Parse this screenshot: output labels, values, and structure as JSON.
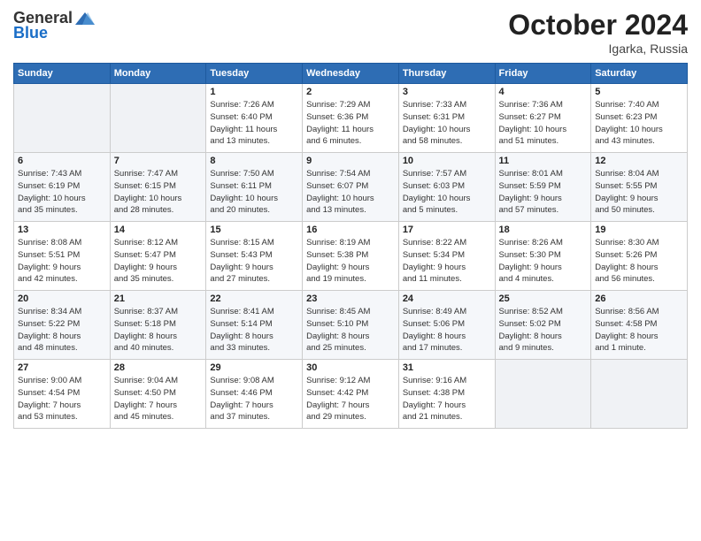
{
  "logo": {
    "general": "General",
    "blue": "Blue"
  },
  "header": {
    "title": "October 2024",
    "location": "Igarka, Russia"
  },
  "days_of_week": [
    "Sunday",
    "Monday",
    "Tuesday",
    "Wednesday",
    "Thursday",
    "Friday",
    "Saturday"
  ],
  "weeks": [
    [
      {
        "day": "",
        "info": ""
      },
      {
        "day": "",
        "info": ""
      },
      {
        "day": "1",
        "info": "Sunrise: 7:26 AM\nSunset: 6:40 PM\nDaylight: 11 hours\nand 13 minutes."
      },
      {
        "day": "2",
        "info": "Sunrise: 7:29 AM\nSunset: 6:36 PM\nDaylight: 11 hours\nand 6 minutes."
      },
      {
        "day": "3",
        "info": "Sunrise: 7:33 AM\nSunset: 6:31 PM\nDaylight: 10 hours\nand 58 minutes."
      },
      {
        "day": "4",
        "info": "Sunrise: 7:36 AM\nSunset: 6:27 PM\nDaylight: 10 hours\nand 51 minutes."
      },
      {
        "day": "5",
        "info": "Sunrise: 7:40 AM\nSunset: 6:23 PM\nDaylight: 10 hours\nand 43 minutes."
      }
    ],
    [
      {
        "day": "6",
        "info": "Sunrise: 7:43 AM\nSunset: 6:19 PM\nDaylight: 10 hours\nand 35 minutes."
      },
      {
        "day": "7",
        "info": "Sunrise: 7:47 AM\nSunset: 6:15 PM\nDaylight: 10 hours\nand 28 minutes."
      },
      {
        "day": "8",
        "info": "Sunrise: 7:50 AM\nSunset: 6:11 PM\nDaylight: 10 hours\nand 20 minutes."
      },
      {
        "day": "9",
        "info": "Sunrise: 7:54 AM\nSunset: 6:07 PM\nDaylight: 10 hours\nand 13 minutes."
      },
      {
        "day": "10",
        "info": "Sunrise: 7:57 AM\nSunset: 6:03 PM\nDaylight: 10 hours\nand 5 minutes."
      },
      {
        "day": "11",
        "info": "Sunrise: 8:01 AM\nSunset: 5:59 PM\nDaylight: 9 hours\nand 57 minutes."
      },
      {
        "day": "12",
        "info": "Sunrise: 8:04 AM\nSunset: 5:55 PM\nDaylight: 9 hours\nand 50 minutes."
      }
    ],
    [
      {
        "day": "13",
        "info": "Sunrise: 8:08 AM\nSunset: 5:51 PM\nDaylight: 9 hours\nand 42 minutes."
      },
      {
        "day": "14",
        "info": "Sunrise: 8:12 AM\nSunset: 5:47 PM\nDaylight: 9 hours\nand 35 minutes."
      },
      {
        "day": "15",
        "info": "Sunrise: 8:15 AM\nSunset: 5:43 PM\nDaylight: 9 hours\nand 27 minutes."
      },
      {
        "day": "16",
        "info": "Sunrise: 8:19 AM\nSunset: 5:38 PM\nDaylight: 9 hours\nand 19 minutes."
      },
      {
        "day": "17",
        "info": "Sunrise: 8:22 AM\nSunset: 5:34 PM\nDaylight: 9 hours\nand 11 minutes."
      },
      {
        "day": "18",
        "info": "Sunrise: 8:26 AM\nSunset: 5:30 PM\nDaylight: 9 hours\nand 4 minutes."
      },
      {
        "day": "19",
        "info": "Sunrise: 8:30 AM\nSunset: 5:26 PM\nDaylight: 8 hours\nand 56 minutes."
      }
    ],
    [
      {
        "day": "20",
        "info": "Sunrise: 8:34 AM\nSunset: 5:22 PM\nDaylight: 8 hours\nand 48 minutes."
      },
      {
        "day": "21",
        "info": "Sunrise: 8:37 AM\nSunset: 5:18 PM\nDaylight: 8 hours\nand 40 minutes."
      },
      {
        "day": "22",
        "info": "Sunrise: 8:41 AM\nSunset: 5:14 PM\nDaylight: 8 hours\nand 33 minutes."
      },
      {
        "day": "23",
        "info": "Sunrise: 8:45 AM\nSunset: 5:10 PM\nDaylight: 8 hours\nand 25 minutes."
      },
      {
        "day": "24",
        "info": "Sunrise: 8:49 AM\nSunset: 5:06 PM\nDaylight: 8 hours\nand 17 minutes."
      },
      {
        "day": "25",
        "info": "Sunrise: 8:52 AM\nSunset: 5:02 PM\nDaylight: 8 hours\nand 9 minutes."
      },
      {
        "day": "26",
        "info": "Sunrise: 8:56 AM\nSunset: 4:58 PM\nDaylight: 8 hours\nand 1 minute."
      }
    ],
    [
      {
        "day": "27",
        "info": "Sunrise: 9:00 AM\nSunset: 4:54 PM\nDaylight: 7 hours\nand 53 minutes."
      },
      {
        "day": "28",
        "info": "Sunrise: 9:04 AM\nSunset: 4:50 PM\nDaylight: 7 hours\nand 45 minutes."
      },
      {
        "day": "29",
        "info": "Sunrise: 9:08 AM\nSunset: 4:46 PM\nDaylight: 7 hours\nand 37 minutes."
      },
      {
        "day": "30",
        "info": "Sunrise: 9:12 AM\nSunset: 4:42 PM\nDaylight: 7 hours\nand 29 minutes."
      },
      {
        "day": "31",
        "info": "Sunrise: 9:16 AM\nSunset: 4:38 PM\nDaylight: 7 hours\nand 21 minutes."
      },
      {
        "day": "",
        "info": ""
      },
      {
        "day": "",
        "info": ""
      }
    ]
  ]
}
